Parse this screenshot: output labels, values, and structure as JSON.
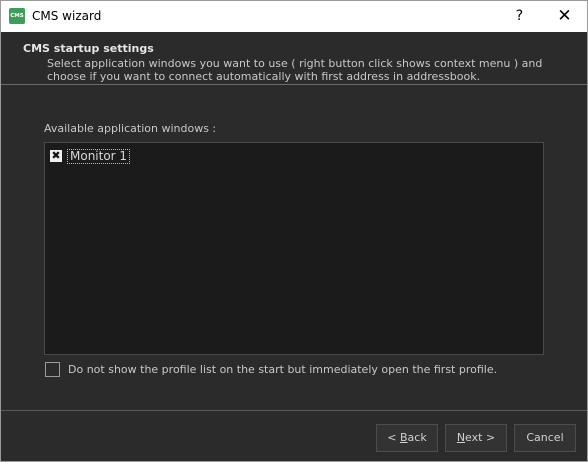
{
  "window": {
    "title": "CMS wizard",
    "app_icon_text": "CMS",
    "help_glyph": "?",
    "close_glyph": "✕"
  },
  "header": {
    "title": "CMS startup settings",
    "description": "Select application windows you want to use ( right button click shows context menu ) and choose if you want to connect automatically with first address in addressbook."
  },
  "main": {
    "list_label": "Available application windows :",
    "items": [
      {
        "label": "Monitor 1",
        "checked": true,
        "check_glyph": "✖"
      }
    ],
    "option": {
      "label": "Do not show the profile list on the start but immediately open the first profile.",
      "checked": false
    }
  },
  "footer": {
    "back": {
      "pre": "< ",
      "accel": "B",
      "post": "ack"
    },
    "next": {
      "accel": "N",
      "post": "ext >"
    },
    "cancel": "Cancel"
  }
}
